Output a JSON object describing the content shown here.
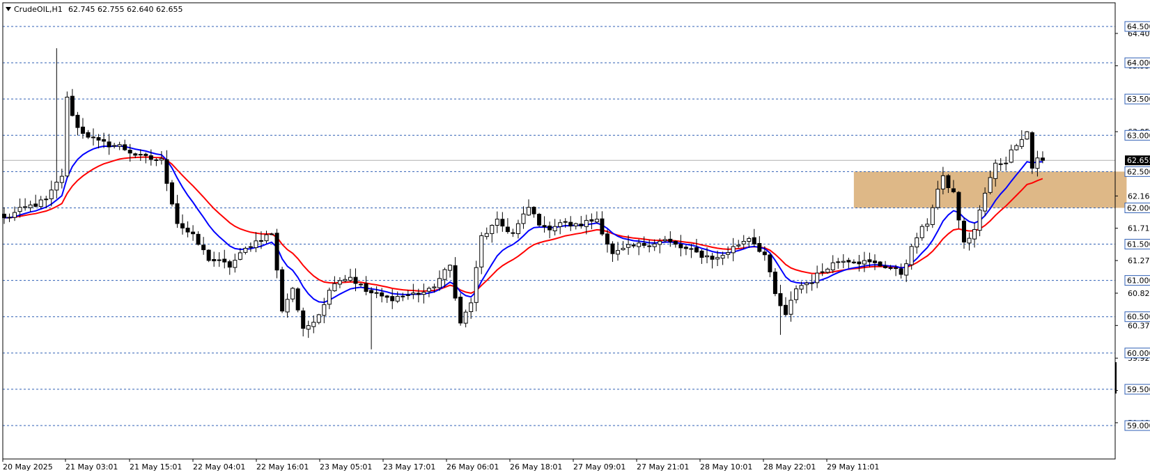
{
  "header": {
    "symbol": "CrudeOIL,H1",
    "ohlc": "62.745 62.755 62.640 62.655"
  },
  "colors": {
    "ema_fast": "#0000ff",
    "ema_slow": "#ff0000",
    "level_line": "#2f5fb4",
    "zone": "#deb887",
    "bull_body": "#ffffff",
    "bear_body": "#000000"
  },
  "chart_data": {
    "type": "candlestick",
    "symbol": "CrudeOIL",
    "timeframe": "H1",
    "ylim": [
      58.95,
      65.0
    ],
    "price_ticks": [
      "64.404",
      "63.959",
      "63.050",
      "62.164",
      "61.719",
      "61.274",
      "60.824",
      "60.379",
      "59.929",
      "59.484",
      "59.039"
    ],
    "level_labels": [
      "64.500",
      "64.000",
      "63.500",
      "63.000",
      "62.500",
      "62.000",
      "61.500",
      "61.000",
      "60.500",
      "60.000",
      "59.500",
      "59.000"
    ],
    "current_price": "62.655",
    "x_labels": [
      "20 May 2025",
      "21 May 03:01",
      "21 May 15:01",
      "22 May 04:01",
      "22 May 16:01",
      "23 May 05:01",
      "23 May 17:01",
      "26 May 06:01",
      "26 May 18:01",
      "27 May 09:01",
      "27 May 21:01",
      "28 May 10:01",
      "28 May 22:01",
      "29 May 11:01"
    ],
    "zone": {
      "low": 62.0,
      "high": 62.5,
      "start_bar": 162,
      "end_bar": 214
    },
    "close_anchors": [
      [
        0,
        61.85
      ],
      [
        4,
        62.0
      ],
      [
        8,
        62.1
      ],
      [
        11,
        62.45
      ],
      [
        12,
        63.5
      ],
      [
        14,
        63.1
      ],
      [
        18,
        62.9
      ],
      [
        22,
        62.85
      ],
      [
        26,
        62.7
      ],
      [
        30,
        62.65
      ],
      [
        33,
        61.8
      ],
      [
        36,
        61.6
      ],
      [
        39,
        61.3
      ],
      [
        43,
        61.2
      ],
      [
        47,
        61.5
      ],
      [
        51,
        61.65
      ],
      [
        53,
        60.6
      ],
      [
        55,
        60.9
      ],
      [
        57,
        60.3
      ],
      [
        60,
        60.55
      ],
      [
        63,
        61.0
      ],
      [
        66,
        61.05
      ],
      [
        69,
        60.85
      ],
      [
        73,
        60.75
      ],
      [
        77,
        60.8
      ],
      [
        81,
        60.85
      ],
      [
        85,
        61.2
      ],
      [
        87,
        60.4
      ],
      [
        89,
        60.7
      ],
      [
        91,
        61.6
      ],
      [
        94,
        61.8
      ],
      [
        97,
        61.65
      ],
      [
        100,
        62.0
      ],
      [
        103,
        61.7
      ],
      [
        106,
        61.8
      ],
      [
        109,
        61.75
      ],
      [
        113,
        61.85
      ],
      [
        116,
        61.35
      ],
      [
        119,
        61.45
      ],
      [
        122,
        61.5
      ],
      [
        126,
        61.55
      ],
      [
        129,
        61.45
      ],
      [
        133,
        61.35
      ],
      [
        136,
        61.3
      ],
      [
        139,
        61.45
      ],
      [
        142,
        61.6
      ],
      [
        145,
        61.35
      ],
      [
        147,
        60.8
      ],
      [
        149,
        60.5
      ],
      [
        151,
        60.9
      ],
      [
        154,
        61.0
      ],
      [
        157,
        61.2
      ],
      [
        160,
        61.3
      ],
      [
        164,
        61.25
      ],
      [
        168,
        61.2
      ],
      [
        171,
        61.1
      ],
      [
        174,
        61.6
      ],
      [
        176,
        61.8
      ],
      [
        178,
        62.25
      ],
      [
        179,
        62.4
      ],
      [
        181,
        62.2
      ],
      [
        183,
        61.5
      ],
      [
        185,
        61.7
      ],
      [
        187,
        62.2
      ],
      [
        189,
        62.6
      ],
      [
        191,
        62.65
      ],
      [
        193,
        62.9
      ],
      [
        195,
        63.05
      ],
      [
        196,
        62.55
      ],
      [
        197,
        62.7
      ],
      [
        198,
        62.655
      ]
    ],
    "ema_fast_period": 10,
    "ema_slow_period": 20,
    "bar_count": 199
  }
}
